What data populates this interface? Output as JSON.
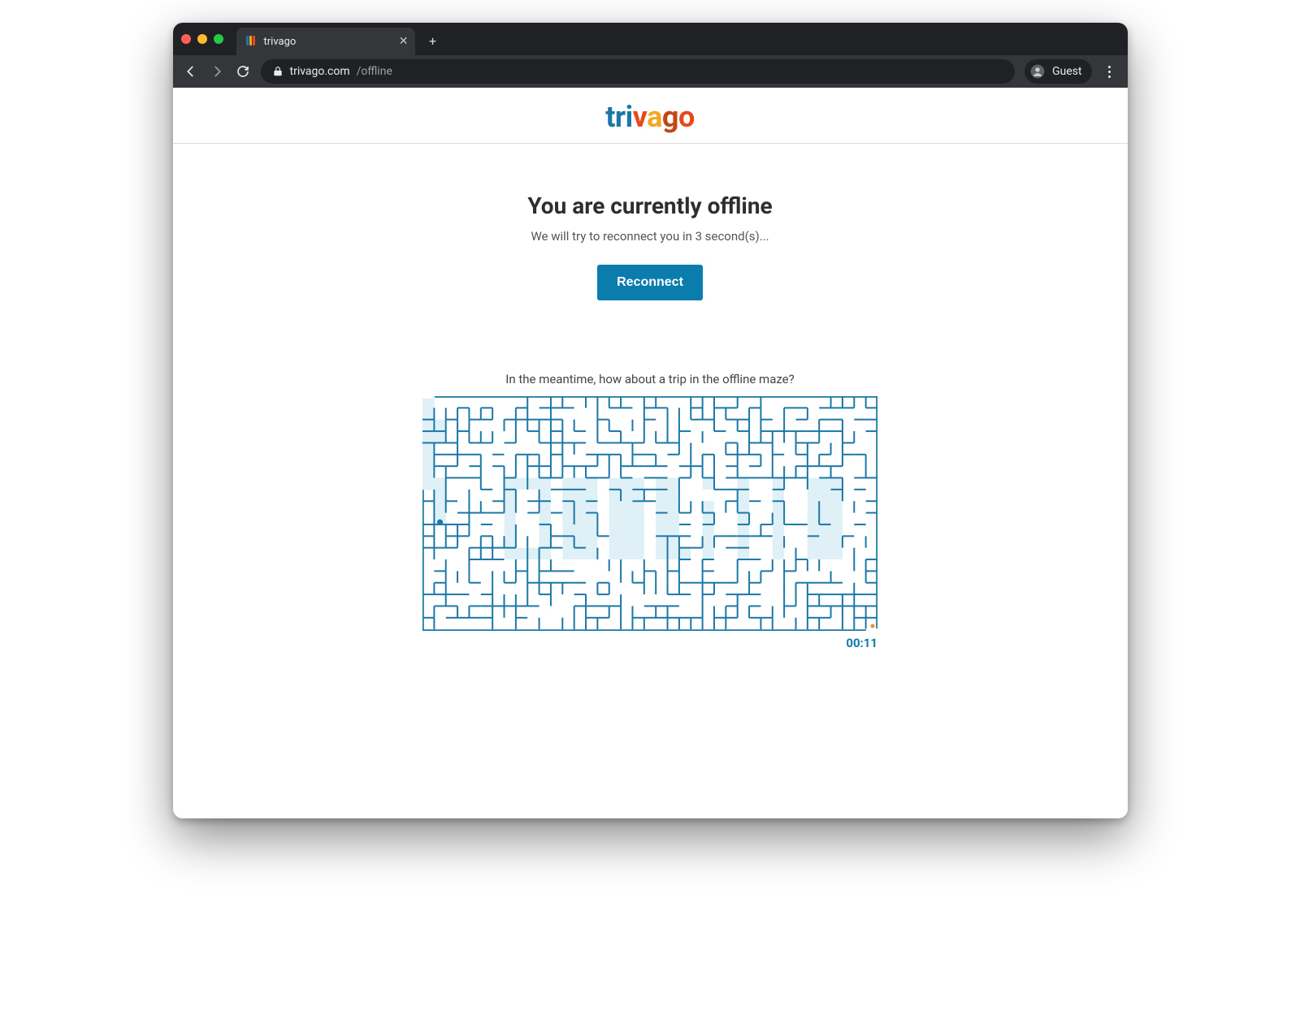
{
  "browser": {
    "tab_title": "trivago",
    "url_host": "trivago.com",
    "url_path": "/offline",
    "guest_label": "Guest"
  },
  "logo": {
    "tri": "tri",
    "v": "v",
    "a": "a",
    "g": "g",
    "o": "o"
  },
  "offline": {
    "title": "You are currently offline",
    "subtitle": "We will try to reconnect you in 3 second(s)...",
    "button_label": "Reconnect"
  },
  "maze": {
    "lead": "In the meantime, how about a trip in the offline maze?",
    "word": "OFFLiNE",
    "timer": "00:11",
    "color_wall": "#1b78a6",
    "color_backfill": "#dff1f7"
  }
}
